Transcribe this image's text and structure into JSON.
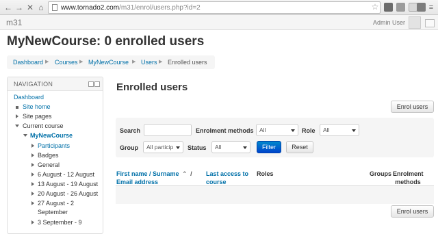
{
  "browser": {
    "url_host": "www.tornado2.com",
    "url_path": "/m31/enrol/users.php?id=2"
  },
  "navbar": {
    "site_name": "m31",
    "user_name": "Admin User"
  },
  "page": {
    "title": "MyNewCourse: 0 enrolled users"
  },
  "breadcrumb": [
    "Dashboard",
    "Courses",
    "MyNewCourse",
    "Users",
    "Enrolled users"
  ],
  "navigation": {
    "title": "NAVIGATION",
    "items": [
      "Dashboard",
      "Site home",
      "Site pages",
      "Current course",
      "MyNewCourse",
      "Participants",
      "Badges",
      "General",
      "6 August - 12 August",
      "13 August - 19 August",
      "20 August - 26 August",
      "27 August - 2",
      "September",
      "3 September - 9"
    ]
  },
  "main": {
    "heading": "Enrolled users",
    "enrol_button": "Enrol users",
    "enrol_button_bottom": "Enrol users",
    "filter": {
      "search_label": "Search",
      "search_value": "",
      "methods_label": "Enrolment methods",
      "methods_value": "All",
      "role_label": "Role",
      "role_value": "All",
      "group_label": "Group",
      "group_value": "All particip",
      "status_label": "Status",
      "status_value": "All",
      "filter_button": "Filter",
      "reset_button": "Reset"
    },
    "columns": {
      "name_line1": "First name / Surname",
      "name_sort": "⌃",
      "name_slash": "/",
      "name_line2": "Email address",
      "access_line1": "Last access to",
      "access_line2": "course",
      "roles": "Roles",
      "groups": "Groups",
      "methods_line1": "Enrolment",
      "methods_line2": "methods"
    }
  }
}
